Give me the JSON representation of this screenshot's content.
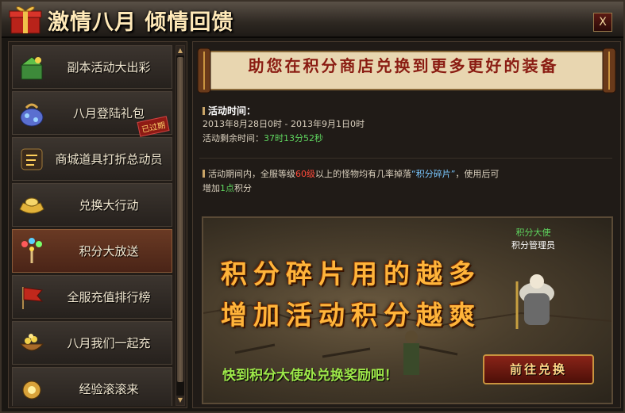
{
  "window": {
    "title": "激情八月 倾情回馈",
    "close_label": "X"
  },
  "menu": {
    "items": [
      {
        "label": "副本活动大出彩",
        "active": false
      },
      {
        "label": "八月登陆礼包",
        "badge": "已过期",
        "active": false
      },
      {
        "label": "商城道具打折总动员",
        "active": false
      },
      {
        "label": "兑换大行动",
        "active": false
      },
      {
        "label": "积分大放送",
        "active": true
      },
      {
        "label": "全服充值排行榜",
        "active": false
      },
      {
        "label": "八月我们一起充",
        "active": false
      },
      {
        "label": "经验滚滚来",
        "active": false
      }
    ]
  },
  "banner": {
    "text": "助您在积分商店兑换到更多更好的装备"
  },
  "activity": {
    "time_heading": "活动时间：",
    "time_range": "2013年8月28日0时 - 2013年9月1日0时",
    "remaining_label": "活动剩余时间：",
    "remaining_value": "37时13分52秒",
    "desc_part1": "活动期间内，全服等级",
    "desc_level": "60级",
    "desc_part2": "以上的怪物均有几率掉落",
    "desc_item": "“积分碎片”",
    "desc_part3": "，使用后可",
    "desc_line2_part1": "增加",
    "desc_points": "1点",
    "desc_line2_part2": "积分"
  },
  "promo": {
    "headline1": "积分碎片用的越多",
    "headline2": "增加活动积分越爽",
    "npc_title": "积分大使",
    "npc_name": "积分管理员",
    "cta_text": "快到积分大使处兑换奖励吧！",
    "button_label": "前往兑换"
  }
}
